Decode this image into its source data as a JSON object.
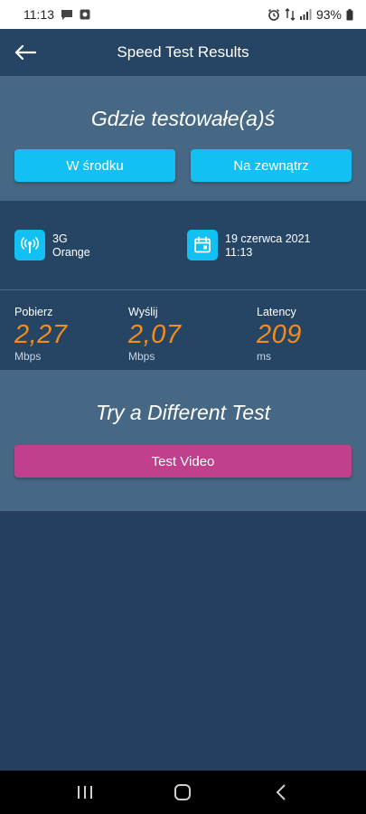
{
  "status_bar": {
    "time": "11:13",
    "battery": "93%",
    "icons": [
      "message-icon",
      "media-icon",
      "alarm-icon",
      "signal-4g-icon",
      "signal-bars-icon",
      "battery-icon"
    ]
  },
  "header": {
    "title": "Speed Test Results",
    "back_icon": "arrow-left-icon"
  },
  "location": {
    "heading": "Gdzie testowałe(a)ś",
    "inside_label": "W środku",
    "outside_label": "Na zewnątrz"
  },
  "info": {
    "network_type": "3G",
    "carrier": "Orange",
    "date": "19 czerwca 2021",
    "time": "11:13",
    "network_icon": "antenna-icon",
    "date_icon": "calendar-icon"
  },
  "results": {
    "download": {
      "label": "Pobierz",
      "value": "2,27",
      "unit": "Mbps"
    },
    "upload": {
      "label": "Wyślij",
      "value": "2,07",
      "unit": "Mbps"
    },
    "latency": {
      "label": "Latency",
      "value": "209",
      "unit": "ms"
    }
  },
  "different_test": {
    "heading": "Try a Different Test",
    "button_label": "Test Video"
  },
  "nav_bar": {
    "buttons": [
      "recents-icon",
      "home-icon",
      "back-icon"
    ]
  },
  "colors": {
    "accent_blue": "#12c0f4",
    "value_orange": "#f28c1c",
    "video_button": "#c1408c",
    "section_light": "#466885",
    "section_dark": "#264565"
  }
}
